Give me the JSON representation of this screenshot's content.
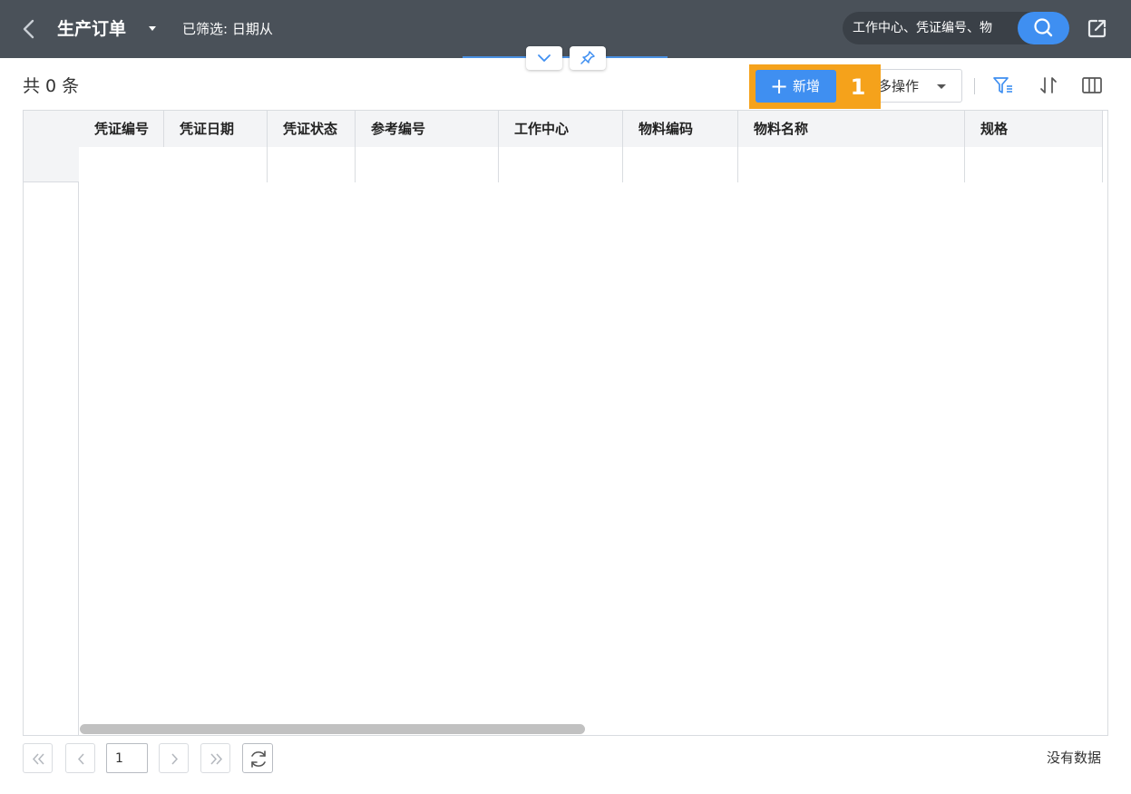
{
  "header": {
    "title": "生产订单",
    "filter_text": "已筛选: 日期从",
    "search_placeholder": "工作中心、凭证编号、物",
    "background_color": "#4a5159"
  },
  "toolbar": {
    "count_label": "共 0 条",
    "add_plus": "+",
    "add_label": "新增",
    "more_ops_label": "多操作",
    "step_badge": "1",
    "accent_color": "#3f8ff1",
    "highlight_color": "#f5a21b"
  },
  "table": {
    "columns": [
      "凭证编号",
      "凭证日期",
      "凭证状态",
      "参考编号",
      "工作中心",
      "物料编码",
      "物料名称",
      "规格"
    ]
  },
  "pager": {
    "current_page": "1",
    "status_text": "没有数据"
  }
}
